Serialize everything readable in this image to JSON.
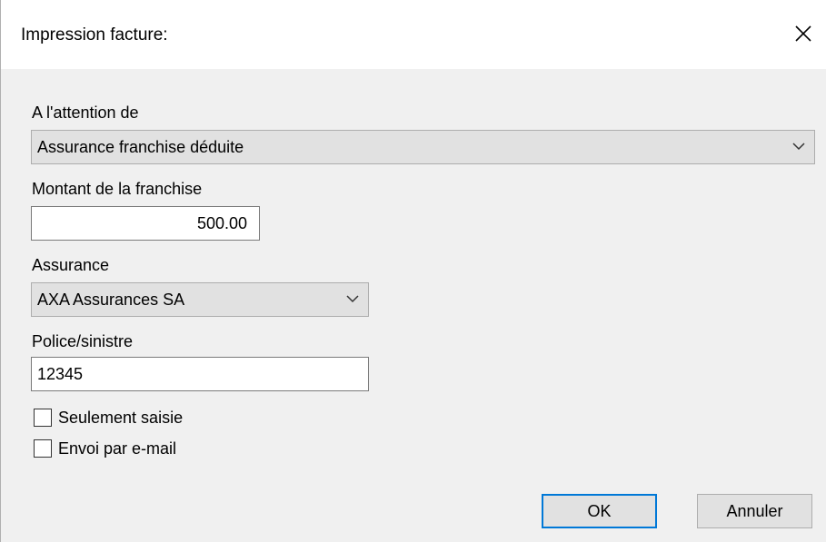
{
  "dialog": {
    "title": "Impression facture:"
  },
  "recipient": {
    "label": "A l'attention de",
    "value": "Assurance franchise déduite"
  },
  "deductible": {
    "label": "Montant de la franchise",
    "value": "500.00"
  },
  "insurer": {
    "label": "Assurance",
    "value": "AXA Assurances SA"
  },
  "policy": {
    "label": "Police/sinistre",
    "value": "12345"
  },
  "options": {
    "entry_only": {
      "label": "Seulement saisie",
      "checked": false
    },
    "send_email": {
      "label": "Envoi par e-mail",
      "checked": false
    }
  },
  "buttons": {
    "ok": "OK",
    "cancel": "Annuler"
  }
}
